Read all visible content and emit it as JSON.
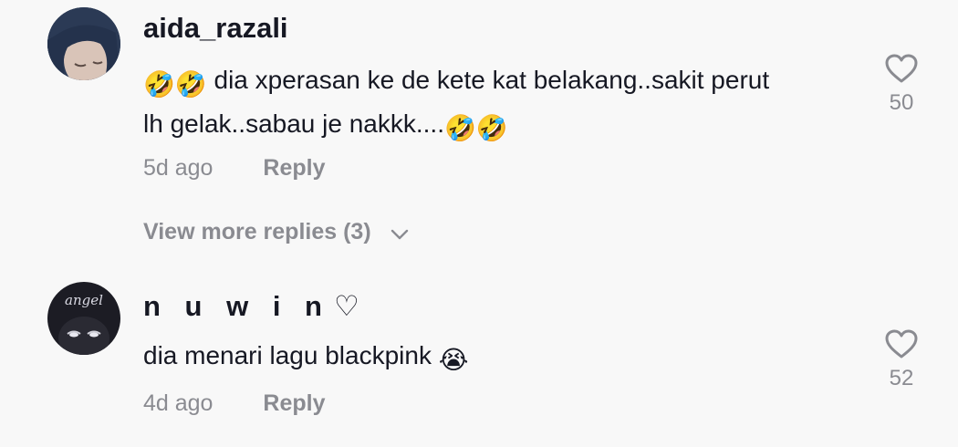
{
  "comments": [
    {
      "username": "aida_razali",
      "avatar_icon": "avatar-hijab-icon",
      "text_prefix_emoji": "🤣🤣",
      "text_line1": " dia xperasan ke de kete kat belakang..sakit perut",
      "text_line2": "lh gelak..sabau je nakkk....",
      "text_suffix_emoji": "🤣🤣",
      "time": "5d ago",
      "reply_label": "Reply",
      "likes": "50"
    },
    {
      "username": "n u w i n",
      "username_suffix": "♡",
      "avatar_text": "angel",
      "text": "dia menari lagu blackpink ",
      "text_emoji": "😭",
      "time": "4d ago",
      "reply_label": "Reply",
      "likes": "52"
    }
  ],
  "view_more": {
    "label": "View more replies (3)",
    "icon": "chevron-down-icon"
  },
  "colors": {
    "background": "#f8f8f8",
    "primary_text": "#161823",
    "secondary_text": "#8a8b91"
  }
}
